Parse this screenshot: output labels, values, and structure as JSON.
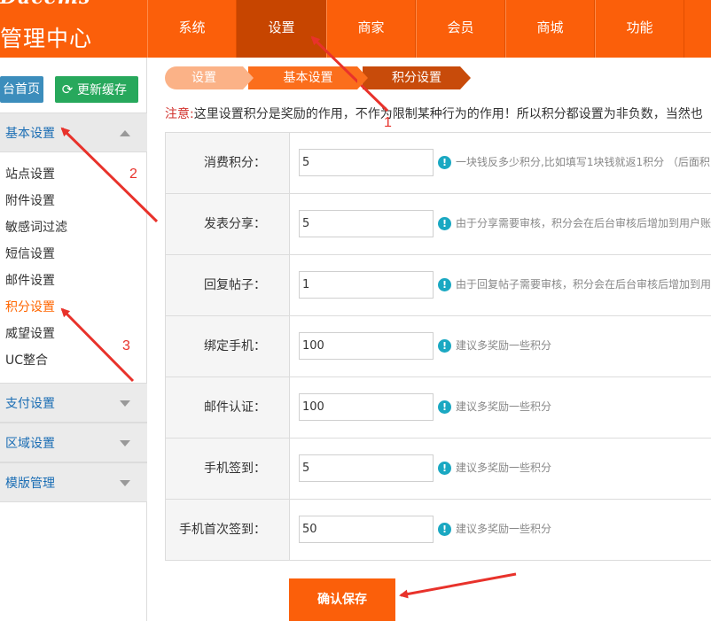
{
  "header": {
    "logo_text": "Dacems",
    "title": "管理中心",
    "nav": [
      "系统",
      "设置",
      "商家",
      "会员",
      "商城",
      "功能"
    ],
    "active_nav": "设置"
  },
  "sidebar": {
    "home_button": "台首页",
    "cache_button": "更新缓存",
    "cache_icon": "refresh-icon",
    "groups": {
      "basic": "基本设置",
      "pay": "支付设置",
      "area": "区域设置",
      "template": "模版管理"
    },
    "basic_items": [
      "站点设置",
      "附件设置",
      "敏感词过滤",
      "短信设置",
      "邮件设置",
      "积分设置",
      "威望设置",
      "UC整合"
    ],
    "active_item": "积分设置"
  },
  "breadcrumb": [
    "设置",
    "基本设置",
    "积分设置"
  ],
  "notice": {
    "tag": "注意:",
    "text": "这里设置积分是奖励的作用，不作为限制某种行为的作用！所以积分都设置为非负数，当然也"
  },
  "form": {
    "rows": [
      {
        "label": "消费积分：",
        "value": "5",
        "tip": "一块钱反多少积分,比如填写1块钱就返1积分 （后面积"
      },
      {
        "label": "发表分享：",
        "value": "5",
        "tip": "由于分享需要审核，积分会在后台审核后增加到用户账"
      },
      {
        "label": "回复帖子：",
        "value": "1",
        "tip": "由于回复帖子需要审核，积分会在后台审核后增加到用"
      },
      {
        "label": "绑定手机：",
        "value": "100",
        "tip": "建议多奖励一些积分"
      },
      {
        "label": "邮件认证：",
        "value": "100",
        "tip": "建议多奖励一些积分"
      },
      {
        "label": "手机签到：",
        "value": "5",
        "tip": "建议多奖励一些积分"
      },
      {
        "label": "手机首次签到：",
        "value": "50",
        "tip": "建议多奖励一些积分"
      }
    ],
    "tip_icon": "!",
    "save_label": "确认保存"
  },
  "annotations": [
    "1",
    "2",
    "3"
  ],
  "colors": {
    "brand": "#fb5f0a",
    "nav_active": "#c74500",
    "link_active": "#ff6600",
    "tip_icon": "#1aa8c2",
    "annotation": "#e8322b"
  }
}
